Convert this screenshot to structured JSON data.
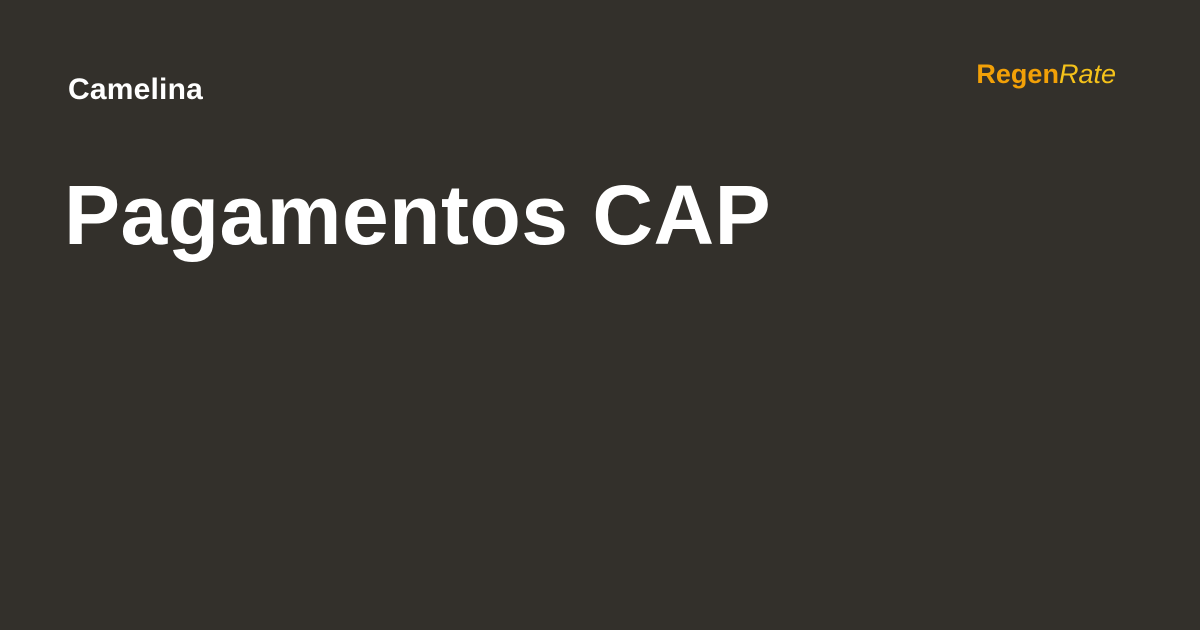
{
  "card": {
    "kicker": "Camelina",
    "headline": "Pagamentos CAP"
  },
  "logo": {
    "part1": "Regen",
    "part2": "Rate",
    "color_primary": "#f2a007",
    "color_secondary": "#f5c21a"
  },
  "colors": {
    "background": "#33302b",
    "text": "#ffffff"
  }
}
